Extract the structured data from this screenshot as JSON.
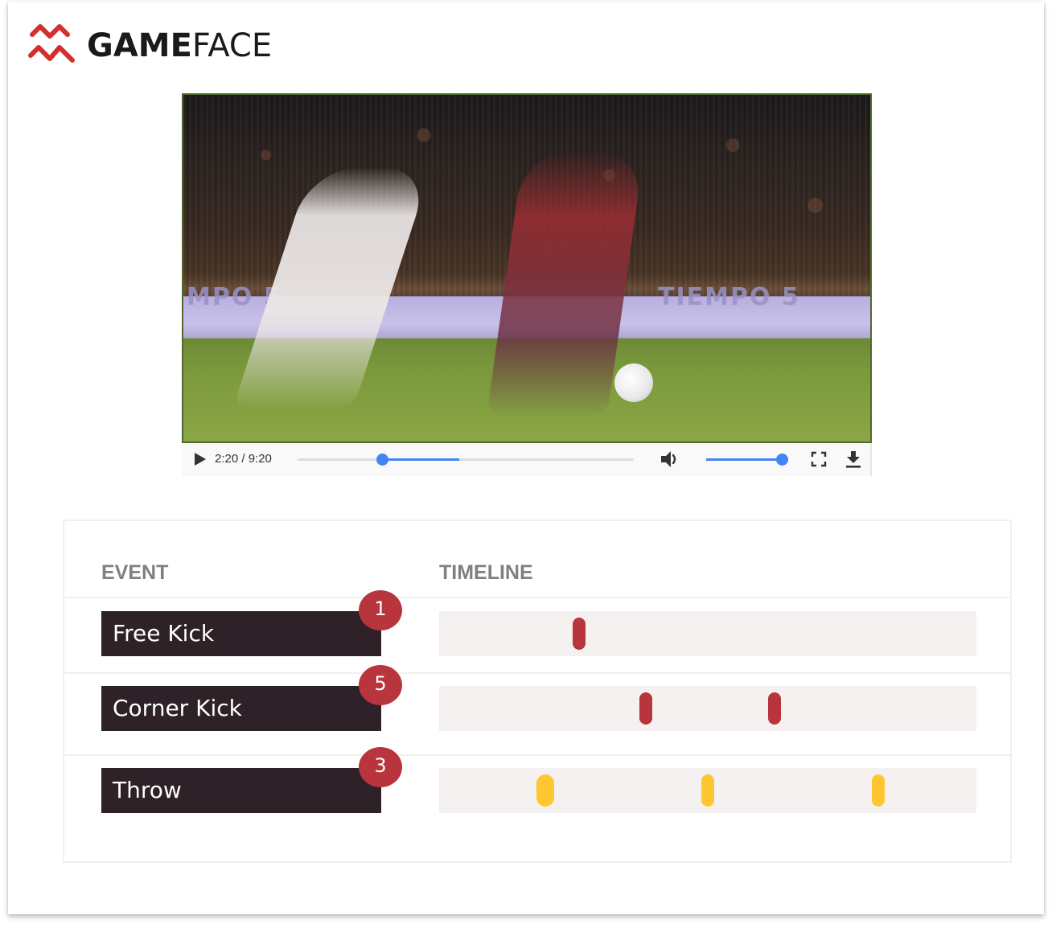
{
  "brand": {
    "name_bold": "GAME",
    "name_light": "FACE",
    "logo_icon": "zigzag-chart-icon",
    "accent_color": "#d32f2f"
  },
  "video": {
    "current_time": "2:20",
    "duration": "9:20",
    "time_display": "2:20 / 9:20",
    "progress_fraction": 0.25,
    "buffered_fraction": 0.48,
    "volume_fraction": 1.0,
    "banner_text_left": "MPO 5",
    "banner_text_right": "TIEMPO 5",
    "controls": {
      "play_icon": "play-icon",
      "volume_icon": "volume-icon",
      "fullscreen_icon": "fullscreen-icon",
      "download_icon": "download-icon"
    },
    "accent_color": "#4285f4"
  },
  "events_panel": {
    "columns": {
      "event": "EVENT",
      "timeline": "TIMELINE"
    },
    "rows": [
      {
        "label": "Free Kick",
        "count": "1",
        "color": "#b8353d",
        "marks": [
          0.26
        ]
      },
      {
        "label": "Corner Kick",
        "count": "5",
        "color": "#b8353d",
        "marks": [
          0.384,
          0.624
        ]
      },
      {
        "label": "Throw",
        "count": "3",
        "color": "#fec630",
        "marks": [
          0.198,
          0.5,
          0.818
        ]
      }
    ],
    "label_bg": "#2e2128",
    "badge_color": "#b8353d",
    "track_bg": "#f6f1f1"
  }
}
